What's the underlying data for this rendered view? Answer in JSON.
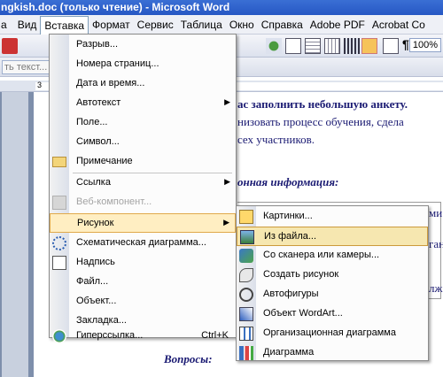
{
  "window": {
    "title": "ngkish.doc (только чтение) - Microsoft Word"
  },
  "menubar": [
    "а",
    "Вид",
    "Вставка",
    "Формат",
    "Сервис",
    "Таблица",
    "Окно",
    "Справка",
    "Adobe PDF",
    "Acrobat Co"
  ],
  "toolbar": {
    "zoom": "100%",
    "pilcrow": "¶",
    "style_box": "ть текст..."
  },
  "ruler": {
    "mark": "3"
  },
  "document": {
    "line1": "ас заполнить небольшую анкету.",
    "line2": "низовать процесс обучения, сдела",
    "line3": "сех участников.",
    "heading": "онная информация:",
    "right1": "ми",
    "right2": "ган",
    "right3": "лж",
    "questions": "Вопросы:"
  },
  "insert_menu": [
    {
      "label": "Разрыв...",
      "icon": "none",
      "arrow": false
    },
    {
      "label": "Номера страниц...",
      "icon": "none",
      "arrow": false
    },
    {
      "label": "Дата и время...",
      "icon": "none",
      "arrow": false
    },
    {
      "label": "Автотекст",
      "icon": "none",
      "arrow": true
    },
    {
      "label": "Поле...",
      "icon": "none",
      "arrow": false
    },
    {
      "label": "Символ...",
      "icon": "none",
      "arrow": false
    },
    {
      "label": "Примечание",
      "icon": "comment-icon",
      "arrow": false
    },
    {
      "label": "Ссылка",
      "icon": "none",
      "arrow": true
    },
    {
      "label": "Веб-компонент...",
      "icon": "web-component-icon",
      "arrow": false,
      "disabled": true
    },
    {
      "label": "Рисунок",
      "icon": "none",
      "arrow": true,
      "highlighted": true
    },
    {
      "label": "Схематическая диаграмма...",
      "icon": "diagram-icon",
      "arrow": false
    },
    {
      "label": "Надпись",
      "icon": "textbox-icon",
      "arrow": false
    },
    {
      "label": "Файл...",
      "icon": "none",
      "arrow": false
    },
    {
      "label": "Объект...",
      "icon": "none",
      "arrow": false
    },
    {
      "label": "Закладка...",
      "icon": "none",
      "arrow": false
    },
    {
      "label": "Гиперссылка...",
      "icon": "hyperlink-icon",
      "arrow": false,
      "shortcut": "Ctrl+K"
    }
  ],
  "picture_menu": [
    {
      "label": "Картинки...",
      "icon": "clipart-icon"
    },
    {
      "label": "Из файла...",
      "icon": "from-file-icon",
      "highlighted": true
    },
    {
      "label": "Со сканера или камеры...",
      "icon": "scanner-icon"
    },
    {
      "label": "Создать рисунок",
      "icon": "new-drawing-icon"
    },
    {
      "label": "Автофигуры",
      "icon": "autoshapes-icon"
    },
    {
      "label": "Объект WordArt...",
      "icon": "wordart-icon"
    },
    {
      "label": "Организационная диаграмма",
      "icon": "org-chart-icon"
    },
    {
      "label": "Диаграмма",
      "icon": "chart-icon"
    }
  ]
}
